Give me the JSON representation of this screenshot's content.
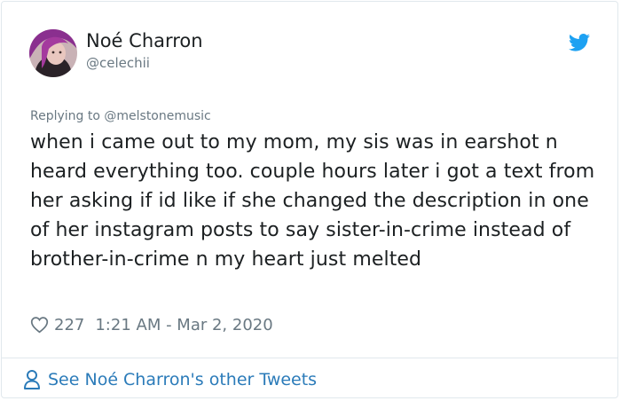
{
  "tweet": {
    "author_name": "Noé Charron",
    "author_handle": "@celechii",
    "replying_to": "Replying to @melstonemusic",
    "text": "when i came out to my mom, my sis was in earshot n heard everything too. couple hours later i got a text from her asking if id like if she changed the description in one of her instagram posts to say sister-in-crime instead of brother-in-crime n my heart just melted",
    "like_count": "227",
    "timestamp": "1:21 AM - Mar 2, 2020"
  },
  "footer": {
    "link_label": "See Noé Charron's other Tweets"
  },
  "icons": {
    "brand": "twitter-bird-icon",
    "like": "heart-icon",
    "profile": "person-icon"
  },
  "colors": {
    "brand_blue": "#1da1f2",
    "link_blue": "#2b7bb9",
    "secondary_text": "#697882",
    "border": "#e1e8ed"
  }
}
